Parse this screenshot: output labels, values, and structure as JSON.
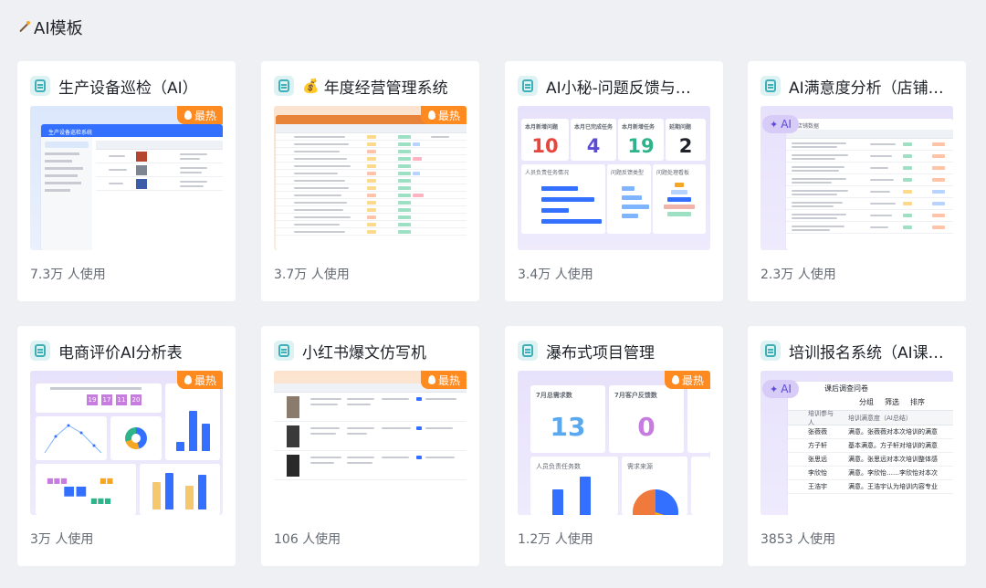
{
  "section": {
    "title": "AI模板"
  },
  "badges": {
    "hot": "最热",
    "ai": "AI"
  },
  "cards": [
    {
      "title": "生产设备巡检（AI）",
      "usage": "7.3万 人使用"
    },
    {
      "title": "年度经营管理系统",
      "usage": "3.7万 人使用"
    },
    {
      "title": "AI小秘-问题反馈与…",
      "usage": "3.4万 人使用"
    },
    {
      "title": "AI满意度分析（店铺…",
      "usage": "2.3万 人使用"
    },
    {
      "title": "电商评价AI分析表",
      "usage": "3万 人使用"
    },
    {
      "title": "小红书爆文仿写机",
      "usage": "106 人使用"
    },
    {
      "title": "瀑布式项目管理",
      "usage": "1.2万 人使用"
    },
    {
      "title": "培训报名系统（AI课…",
      "usage": "3853 人使用"
    }
  ],
  "previews": {
    "inspection": {
      "title": "生产设备巡检系统"
    },
    "feedback": {
      "stats": [
        {
          "label": "本月新增问题",
          "value": "10",
          "color": "#e8453c"
        },
        {
          "label": "本月已完成任务",
          "value": "4",
          "color": "#5b4bd6"
        },
        {
          "label": "本月新增任务",
          "value": "19",
          "color": "#2fb38a"
        },
        {
          "label": "延期问题",
          "value": "2",
          "color": "#1f2329"
        }
      ],
      "panels": [
        "人员负责任务情况",
        "问题反馈类型",
        "问题处理看板"
      ]
    },
    "satisfaction": {
      "tab": "店铺数据"
    },
    "ecommerce": {
      "stats": [
        "19",
        "17",
        "11",
        "20"
      ]
    },
    "waterfall": {
      "stats": [
        {
          "label": "7月总需求数",
          "value": "13",
          "color": "#5aa9f0"
        },
        {
          "label": "7月客户反馈数",
          "value": "0",
          "color": "#c77ddf"
        }
      ],
      "panels": [
        "人员负责任务数",
        "需求来源"
      ]
    },
    "training": {
      "tab": "课后调查问卷",
      "toolbar": [
        "分组",
        "筛选",
        "排序"
      ],
      "headers": [
        "培训参与人",
        "培训满意度（AI总结）"
      ],
      "rows": [
        {
          "name": "张薇薇",
          "summary": "满意。张薇薇对本次培训的满意"
        },
        {
          "name": "方子轩",
          "summary": "基本满意。方子轩对培训的满意"
        },
        {
          "name": "张思远",
          "summary": "满意。张思远对本次培训整体感"
        },
        {
          "name": "李欣怡",
          "summary": "满意。李欣怡……李欣怡对本次"
        },
        {
          "name": "王浩宇",
          "summary": "满意。王浩宇认为培训内容专业"
        }
      ]
    }
  },
  "colors": {
    "hot": "#ff8a1f",
    "accent": "#3370ff",
    "ai": "#5b4bd6"
  }
}
